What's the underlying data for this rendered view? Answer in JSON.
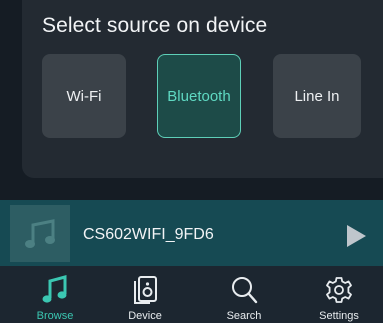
{
  "source_panel": {
    "title": "Select source on device",
    "sources": [
      {
        "label": "Wi-Fi",
        "selected": false
      },
      {
        "label": "Bluetooth",
        "selected": true
      },
      {
        "label": "Line In",
        "selected": false
      }
    ]
  },
  "now_playing": {
    "title": "CS602WIFI_9FD6",
    "art_icon": "music-note-icon",
    "play_icon": "play-icon"
  },
  "tabs": [
    {
      "label": "Browse",
      "icon": "music-note-icon",
      "active": true
    },
    {
      "label": "Device",
      "icon": "speaker-icon",
      "active": false
    },
    {
      "label": "Search",
      "icon": "search-icon",
      "active": false
    },
    {
      "label": "Settings",
      "icon": "gear-icon",
      "active": false
    }
  ],
  "colors": {
    "accent": "#3bc7b2",
    "background": "#0e141b",
    "panel": "#232a32",
    "now_playing_bar": "#164a53",
    "tab_bar": "#1c2630"
  }
}
